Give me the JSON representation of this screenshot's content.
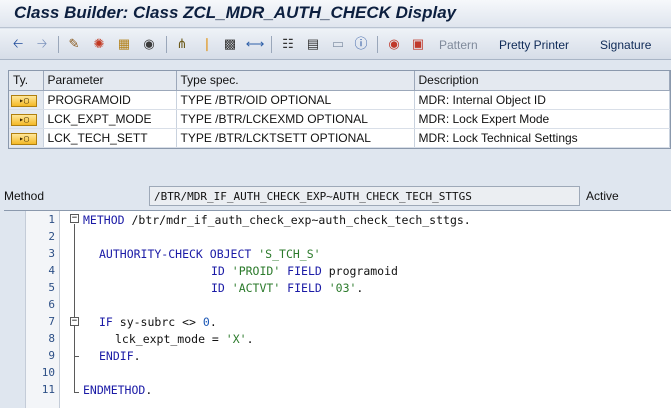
{
  "window": {
    "title": "Class Builder: Class ZCL_MDR_AUTH_CHECK Display"
  },
  "toolbar": {
    "icons": [
      "arrow-back-icon",
      "arrow-forward-icon",
      "edit-pencil-icon",
      "activate-icon",
      "check-object-icon",
      "where-used-icon",
      "object-list-icon",
      "enhance-icon",
      "display-object-icon",
      "navigate-icon",
      "hierarchy-icon",
      "print-icon",
      "frame-icon",
      "info-icon",
      "breakpoint-icon",
      "session-breakpoint-icon"
    ],
    "pattern_label": "Pattern",
    "pretty_printer_label": "Pretty Printer",
    "signature_label": "Signature"
  },
  "params": {
    "headers": {
      "ty": "Ty.",
      "parameter": "Parameter",
      "type_spec": "Type spec.",
      "description": "Description"
    },
    "rows": [
      {
        "ty": "▸▢",
        "parameter": "PROGRAMOID",
        "type_spec": "TYPE /BTR/OID OPTIONAL",
        "description": "MDR: Internal Object ID"
      },
      {
        "ty": "▸▢",
        "parameter": "LCK_EXPT_MODE",
        "type_spec": "TYPE /BTR/LCKEXMD OPTIONAL",
        "description": "MDR: Lock Expert Mode"
      },
      {
        "ty": "▸▢",
        "parameter": "LCK_TECH_SETT",
        "type_spec": "TYPE /BTR/LCKTSETT OPTIONAL",
        "description": "MDR: Lock Technical Settings"
      }
    ]
  },
  "method": {
    "label": "Method",
    "name": "/BTR/MDR_IF_AUTH_CHECK_EXP~AUTH_CHECK_TECH_STTGS",
    "status": "Active"
  },
  "editor": {
    "line_numbers": [
      "1",
      "2",
      "3",
      "4",
      "5",
      "6",
      "7",
      "8",
      "9",
      "10",
      "11"
    ],
    "lines": {
      "l1_kw": "METHOD",
      "l1_tx": " /btr/mdr_if_auth_check_exp~auth_check_tech_sttgs.",
      "l4_kw": "AUTHORITY-CHECK OBJECT",
      "l4_str": " 'S_TCH_S'",
      "l5_kw": "ID",
      "l5_str": " 'PROID'",
      "l5_kw2": " FIELD",
      "l5_tx": " programoid",
      "l6_kw": "ID",
      "l6_str": " 'ACTVT'",
      "l6_kw2": " FIELD",
      "l6_str2": " '03'",
      "l6_tx": ".",
      "l7_kw": "IF",
      "l7_tx": " sy-subrc <> ",
      "l7_num": "0",
      "l7_tx2": ".",
      "l8_tx": "lck_expt_mode = ",
      "l8_str": "'X'",
      "l8_tx2": ".",
      "l9_kw": "ENDIF",
      "l9_tx": ".",
      "l11_kw": "ENDMETHOD",
      "l11_tx": "."
    }
  },
  "colors": {
    "keyword": "#1a1aa6",
    "string": "#2b7a2b",
    "number": "#1a56b5",
    "title": "#0c1f3f"
  }
}
